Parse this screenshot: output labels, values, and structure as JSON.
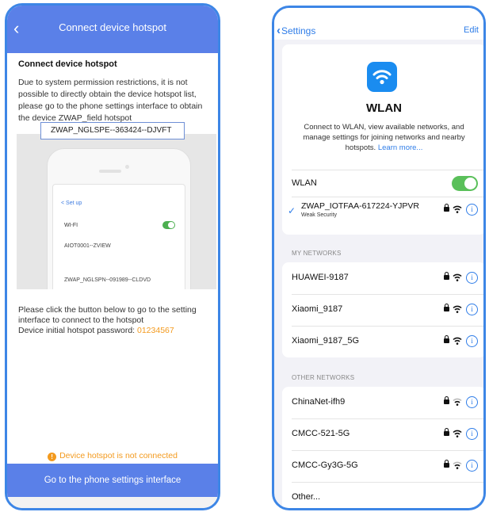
{
  "left": {
    "title": "Connect device hotspot",
    "back_icon": "chevron-left-icon",
    "heading": "Connect device hotspot",
    "description": "Due to system permission restrictions, it is not possible to directly obtain the device hotspot list, please go to the phone settings interface to obtain the device ZWAP_field hotspot",
    "illustration": {
      "back": "< Set up",
      "wifi_label": "WI-FI",
      "network_1": "AIOT0001--ZVIEW",
      "highlighted_network": "ZWAP_NGLSPE--363424--DJVFT",
      "network_2": "ZWAP_NGLSPN--091989--CLDVD"
    },
    "instruction": "Please click the button below to go to the setting interface to connect to the hotspot",
    "password_label": "Device initial hotspot password: ",
    "password_value": "01234567",
    "status": "Device hotspot is not connected",
    "button": "Go to the phone settings interface",
    "colors": {
      "header": "#5a80e8",
      "accent": "#f39a1e"
    }
  },
  "right": {
    "back_label": "Settings",
    "edit_label": "Edit",
    "wlan_heading": "WLAN",
    "wlan_description": "Connect to WLAN, view available networks, and manage settings for joining networks and nearby hotspots.",
    "learn_more": "Learn more...",
    "wlan_toggle_label": "WLAN",
    "wlan_toggle_on": true,
    "connected": {
      "name": "ZWAP_IOTFAA-617224-YJPVR",
      "security": "Weak Security"
    },
    "my_networks_label": "MY NETWORKS",
    "my_networks": [
      {
        "name": "HUAWEI-9187"
      },
      {
        "name": "Xiaomi_9187"
      },
      {
        "name": "Xiaomi_9187_5G"
      }
    ],
    "other_networks_label": "OTHER NETWORKS",
    "other_networks": [
      {
        "name": "ChinaNet-ifh9"
      },
      {
        "name": "CMCC-521-5G"
      },
      {
        "name": "CMCC-Gy3G-5G"
      },
      {
        "name": "Other..."
      }
    ],
    "colors": {
      "link": "#2f7de8",
      "toggle_on": "#5ac05a",
      "wlan_icon_bg": "#1a8cf0"
    }
  }
}
